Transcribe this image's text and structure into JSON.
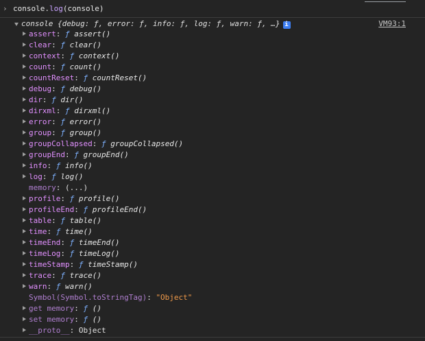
{
  "input": {
    "prompt": "›",
    "code_prefix": "console.",
    "code_method": "log",
    "code_suffix": "(console)"
  },
  "header": {
    "name": "console",
    "preview": " {debug: ƒ, error: ƒ, info: ƒ, log: ƒ, warn: ƒ, …}",
    "info_icon": "i",
    "source": "VM93:1"
  },
  "properties": [
    {
      "key": "assert",
      "fn": "assert()"
    },
    {
      "key": "clear",
      "fn": "clear()"
    },
    {
      "key": "context",
      "fn": "context()"
    },
    {
      "key": "count",
      "fn": "count()"
    },
    {
      "key": "countReset",
      "fn": "countReset()"
    },
    {
      "key": "debug",
      "fn": "debug()"
    },
    {
      "key": "dir",
      "fn": "dir()"
    },
    {
      "key": "dirxml",
      "fn": "dirxml()"
    },
    {
      "key": "error",
      "fn": "error()"
    },
    {
      "key": "group",
      "fn": "group()"
    },
    {
      "key": "groupCollapsed",
      "fn": "groupCollapsed()"
    },
    {
      "key": "groupEnd",
      "fn": "groupEnd()"
    },
    {
      "key": "info",
      "fn": "info()"
    },
    {
      "key": "log",
      "fn": "log()"
    },
    {
      "key": "memory",
      "value": "(...)",
      "expandable": false,
      "dim": true
    },
    {
      "key": "profile",
      "fn": "profile()"
    },
    {
      "key": "profileEnd",
      "fn": "profileEnd()"
    },
    {
      "key": "table",
      "fn": "table()"
    },
    {
      "key": "time",
      "fn": "time()"
    },
    {
      "key": "timeEnd",
      "fn": "timeEnd()"
    },
    {
      "key": "timeLog",
      "fn": "timeLog()"
    },
    {
      "key": "timeStamp",
      "fn": "timeStamp()"
    },
    {
      "key": "trace",
      "fn": "trace()"
    },
    {
      "key": "warn",
      "fn": "warn()"
    },
    {
      "key": "Symbol(Symbol.toStringTag)",
      "string": "\"Object\"",
      "expandable": false,
      "dim": true
    },
    {
      "key": "get memory",
      "fn": "()",
      "dim": true
    },
    {
      "key": "set memory",
      "fn": "()",
      "dim": true
    },
    {
      "key": "__proto__",
      "value": "Object",
      "dim": true
    }
  ],
  "function_marker": "ƒ",
  "colors": {
    "background": "#242424",
    "key": "#e290ff",
    "function_marker": "#7fb2ff",
    "string": "#f09a4a",
    "info_badge": "#3d7ef2"
  }
}
